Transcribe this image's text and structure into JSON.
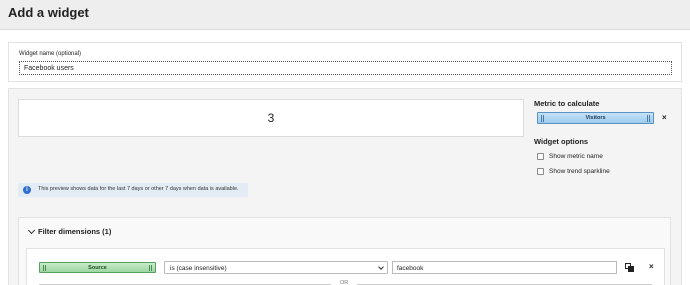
{
  "header": {
    "title": "Add a widget"
  },
  "widget_name": {
    "label": "Widget name (optional)",
    "value": "Facebook users"
  },
  "preview": {
    "value": "3",
    "info_icon": "info-icon",
    "info_text": "This preview shows data for the last 7 days or other 7 days when data is available."
  },
  "metric": {
    "title": "Metric to calculate",
    "selected": "Visitors",
    "accent": "#9ccbee",
    "remove_label": "×"
  },
  "widget_options": {
    "title": "Widget options",
    "items": [
      {
        "label": "Show metric name",
        "checked": false
      },
      {
        "label": "Show trend sparkline",
        "checked": false
      }
    ]
  },
  "filter": {
    "title": "Filter dimensions (1)",
    "rows": [
      {
        "dimension": "Source",
        "dimension_accent": "#9ed6a2",
        "operator": "is (case insensitive)",
        "value": "facebook",
        "remove_label": "×"
      }
    ],
    "or_label": "OR"
  }
}
